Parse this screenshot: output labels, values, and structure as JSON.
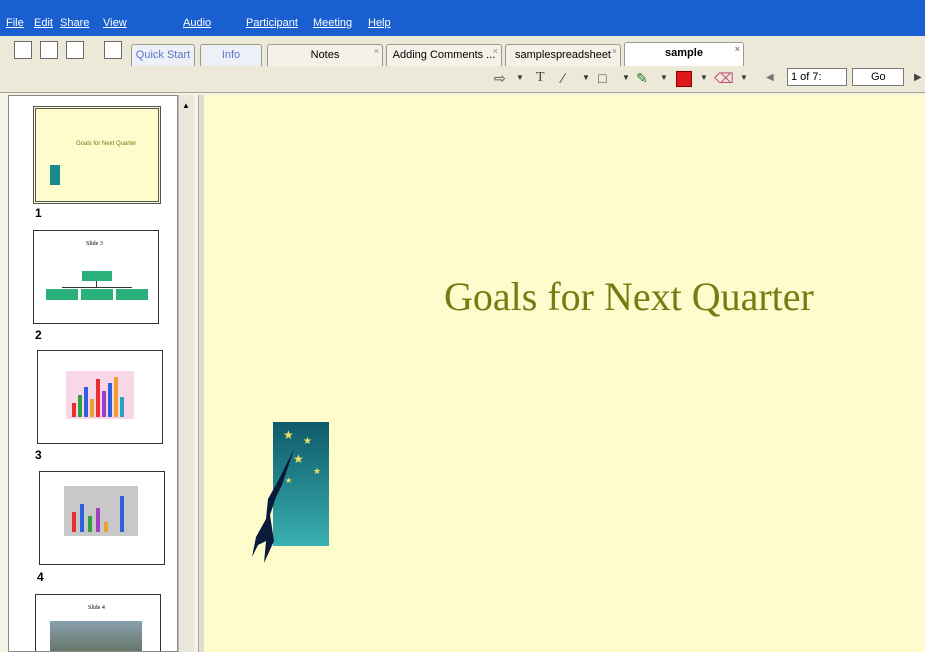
{
  "menu": {
    "items": [
      "File",
      "Edit",
      "Share",
      "View",
      "Audio",
      "Participant",
      "Meeting",
      "Help"
    ]
  },
  "tabs": [
    {
      "label": "Quick Start"
    },
    {
      "label": "Info"
    },
    {
      "label": "Notes"
    },
    {
      "label": "Adding Comments ..."
    },
    {
      "label": "samplespreadsheet"
    },
    {
      "label": "sample"
    }
  ],
  "nav": {
    "page": "1 of 7:",
    "go": "Go"
  },
  "thumbnails": [
    {
      "number": "1",
      "caption": "Goals for Next Quarter"
    },
    {
      "number": "2",
      "caption": "Slide 3"
    },
    {
      "number": "3",
      "caption": ""
    },
    {
      "number": "4",
      "caption": ""
    },
    {
      "number": "",
      "caption": "Slide 4"
    }
  ],
  "slide": {
    "title": "Goals for Next Quarter"
  },
  "colors": {
    "menubar": "#1a5fd0",
    "slide_bg": "#fefbcc",
    "title": "#7a7a12",
    "org_box": "#2ab07a"
  }
}
